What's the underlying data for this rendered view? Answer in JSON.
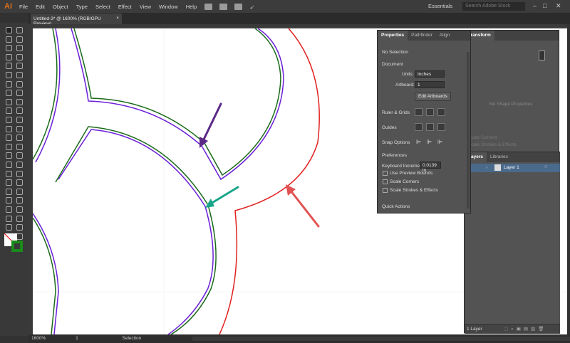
{
  "app": {
    "logo": "Ai",
    "menu": [
      "File",
      "Edit",
      "Object",
      "Type",
      "Select",
      "Effect",
      "View",
      "Window",
      "Help"
    ],
    "workspace": "Essentials",
    "search_placeholder": "Search Adobe Stock"
  },
  "document": {
    "tab_title": "Untitled-3* @ 1600% (RGB/GPU Preview)",
    "close": "×"
  },
  "colors": {
    "purple": "#6a1fd8",
    "green": "#1a6b1a",
    "red": "#e0201e",
    "arrow_purple": "#5b2a86",
    "arrow_teal": "#1aa58a",
    "arrow_red": "#e25252"
  },
  "properties": {
    "tabs": [
      "Properties",
      "Pathfinder",
      "Align"
    ],
    "selection": "No Selection",
    "document_label": "Document",
    "units_label": "Units:",
    "units_value": "Inches",
    "artboard_label": "Artboard:",
    "artboard_value": "1",
    "edit_artboards": "Edit Artboards",
    "rulers_label": "Ruler & Grids",
    "guides_label": "Guides",
    "snap_label": "Snap Options",
    "preferences_label": "Preferences",
    "keyboard_label": "Keyboard Increment:",
    "keyboard_value": "0.0139 in",
    "use_preview_bounds": "Use Preview Bounds",
    "scale_corners": "Scale Corners",
    "scale_strokes": "Scale Strokes & Effects",
    "quick_actions": "Quick Actions"
  },
  "transform": {
    "tab": "Transform",
    "no_shape": "No Shape Properties",
    "scale_corners": "Scale Corners",
    "scale_strokes": "Scale Strokes & Effects"
  },
  "layers": {
    "tabs": [
      "Layers",
      "Libraries"
    ],
    "layer_name": "Layer 1",
    "count": "1 Layer"
  },
  "status": {
    "zoom": "1600%",
    "artboard": "1",
    "tool": "Selection"
  }
}
